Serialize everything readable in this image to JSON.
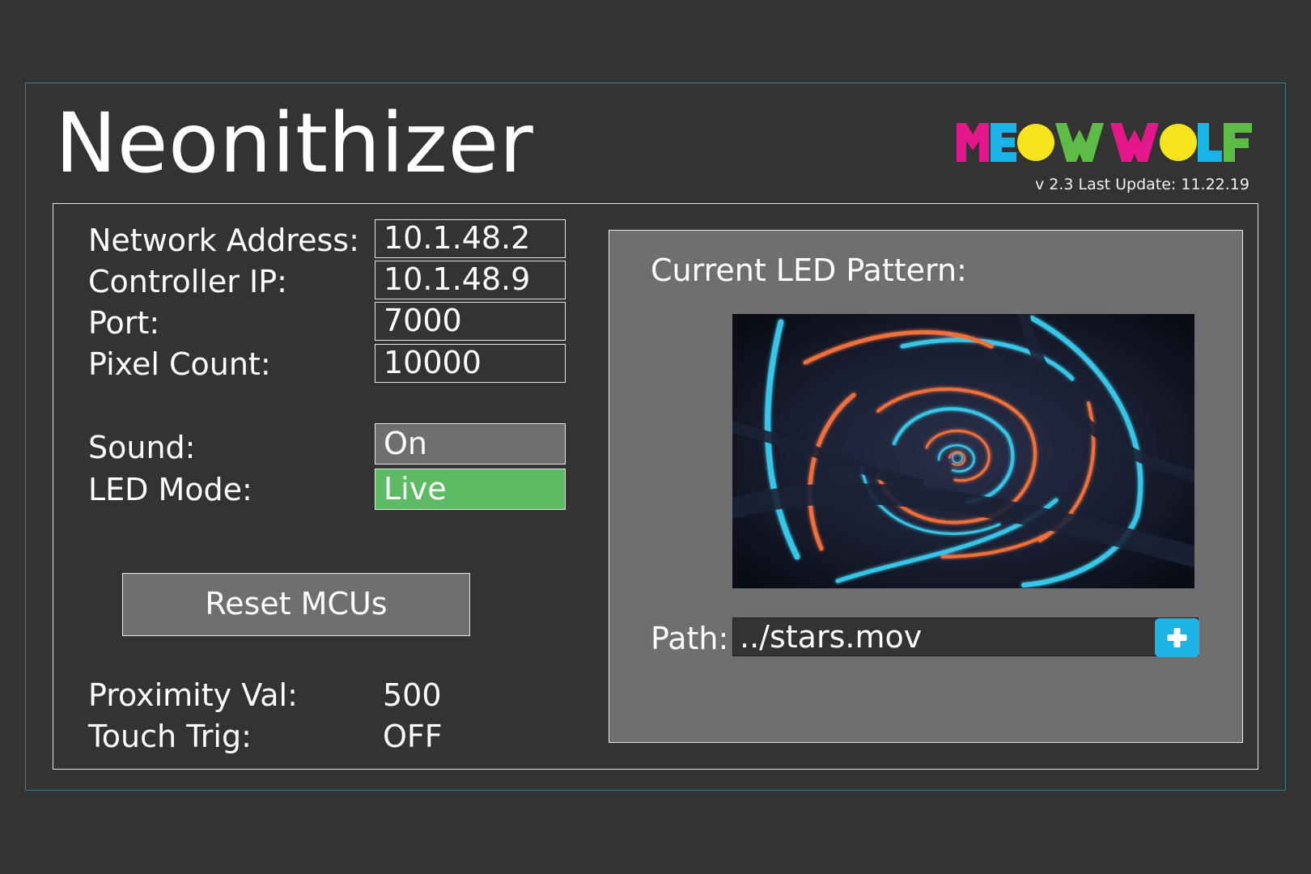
{
  "app": {
    "title": "Neonithizer",
    "logo_text": "MEOW WOLF",
    "version": "v 2.3 Last Update: 11.22.19"
  },
  "settings": {
    "network_address": {
      "label": "Network Address:",
      "value": "10.1.48.2"
    },
    "controller_ip": {
      "label": "Controller IP:",
      "value": "10.1.48.9"
    },
    "port": {
      "label": "Port:",
      "value": "7000"
    },
    "pixel_count": {
      "label": "Pixel Count:",
      "value": "10000"
    },
    "sound": {
      "label": "Sound:",
      "value": "On"
    },
    "led_mode": {
      "label": "LED Mode:",
      "value": "Live"
    }
  },
  "actions": {
    "reset_label": "Reset MCUs"
  },
  "status": {
    "proximity": {
      "label": "Proximity Val:",
      "value": "500"
    },
    "touch": {
      "label": "Touch Trig:",
      "value": "OFF"
    }
  },
  "led": {
    "title": "Current LED Pattern:",
    "path_label": "Path:",
    "path_value": "../stars.mov",
    "add_icon": "plus-icon"
  },
  "colors": {
    "background": "#333333",
    "panel_gray": "#6f6f6f",
    "live_green": "#5dbb63",
    "add_blue": "#1cb5e6",
    "logo_magenta": "#e5178a",
    "logo_cyan": "#18b4e8",
    "logo_yellow": "#f6e51b",
    "logo_green": "#5dbb46"
  }
}
